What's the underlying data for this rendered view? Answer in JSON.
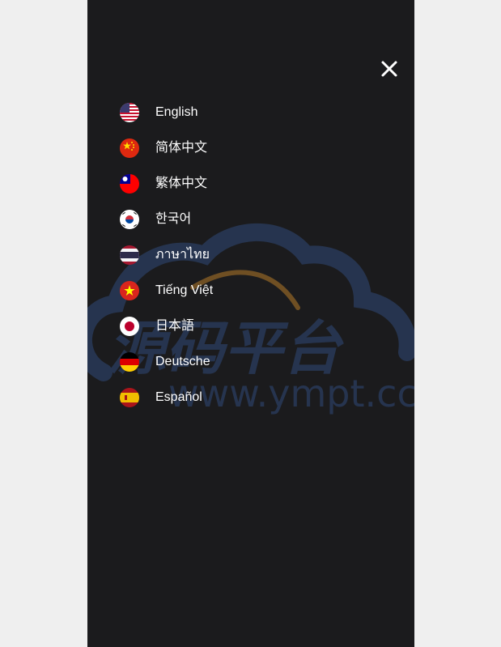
{
  "menu": {
    "close_icon": "close-icon",
    "languages": [
      {
        "label": "English",
        "flag": "us-flag-icon"
      },
      {
        "label": "简体中文",
        "flag": "china-flag-icon"
      },
      {
        "label": "繁体中文",
        "flag": "taiwan-flag-icon"
      },
      {
        "label": "한국어",
        "flag": "korea-flag-icon"
      },
      {
        "label": "ภาษาไทย",
        "flag": "thailand-flag-icon"
      },
      {
        "label": "Tiếng Việt",
        "flag": "vietnam-flag-icon"
      },
      {
        "label": "日本語",
        "flag": "japan-flag-icon"
      },
      {
        "label": "Deutsche",
        "flag": "germany-flag-icon"
      },
      {
        "label": "Español",
        "flag": "spain-flag-icon"
      }
    ]
  },
  "watermark": {
    "title": "源码平台",
    "url": "www.ympt.cc"
  },
  "colors": {
    "page_background": "#efefef",
    "panel_background": "#1b1b1d",
    "text": "#ffffff",
    "watermark_blue": "#2f4a78",
    "watermark_orange": "#d9922a"
  }
}
